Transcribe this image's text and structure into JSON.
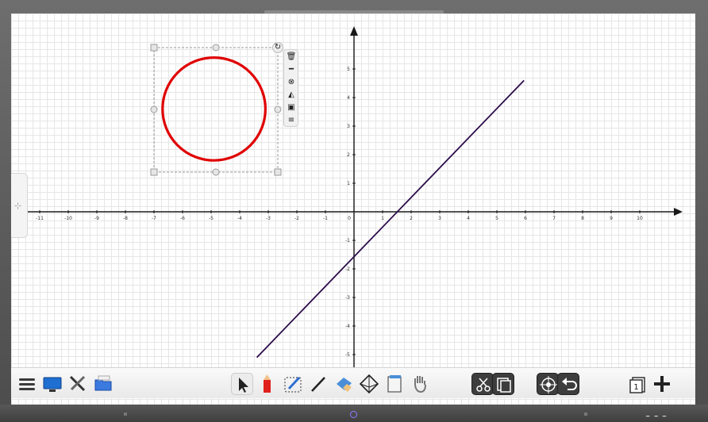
{
  "canvas": {
    "axis_x_ticks": [
      "-11",
      "-10",
      "-9",
      "-8",
      "-7",
      "-6",
      "-5",
      "-4",
      "-3",
      "-2",
      "-1",
      "0",
      "1",
      "2",
      "3",
      "4",
      "5",
      "6",
      "7",
      "8",
      "9",
      "10"
    ],
    "axis_y_ticks_positive": [
      "1",
      "2",
      "3",
      "4",
      "5"
    ],
    "axis_y_ticks_negative": [
      "-1",
      "-2",
      "-3",
      "-4",
      "-5"
    ],
    "line_color": "#2b0b4a",
    "circle_color": "#e00000"
  },
  "chart_data": {
    "type": "line",
    "xlim": [
      -11.5,
      11.5
    ],
    "ylim": [
      -5.5,
      6.5
    ],
    "x_ticks": [
      -11,
      -10,
      -9,
      -8,
      -7,
      -6,
      -5,
      -4,
      -3,
      -2,
      -1,
      0,
      1,
      2,
      3,
      4,
      5,
      6,
      7,
      8,
      9,
      10
    ],
    "y_ticks": [
      -5,
      -4,
      -3,
      -2,
      -1,
      1,
      2,
      3,
      4,
      5
    ],
    "grid": true,
    "series": [
      {
        "x": [
          -3.4,
          5.95
        ],
        "y": [
          -5.1,
          4.6
        ]
      }
    ],
    "shapes": [
      {
        "type": "circle",
        "cx": -4.9,
        "cy": 3.6,
        "r": 1.8
      }
    ]
  },
  "object_toolbar": {
    "items": [
      "trash-icon",
      "pin-icon",
      "link-icon",
      "fill-icon",
      "layer-icon",
      "menu-icon"
    ]
  },
  "toolbar": {
    "left": [
      "menu-icon",
      "screen-icon",
      "tools-icon",
      "folder-icon"
    ],
    "center": [
      "select-icon",
      "pen-icon",
      "smart-pen-icon",
      "line-icon",
      "eraser-icon",
      "shapes-icon",
      "page-icon",
      "hand-icon"
    ],
    "right": [
      "scissors-icon",
      "clone-icon",
      "target-icon",
      "undo-icon"
    ],
    "page_counter": "1"
  }
}
